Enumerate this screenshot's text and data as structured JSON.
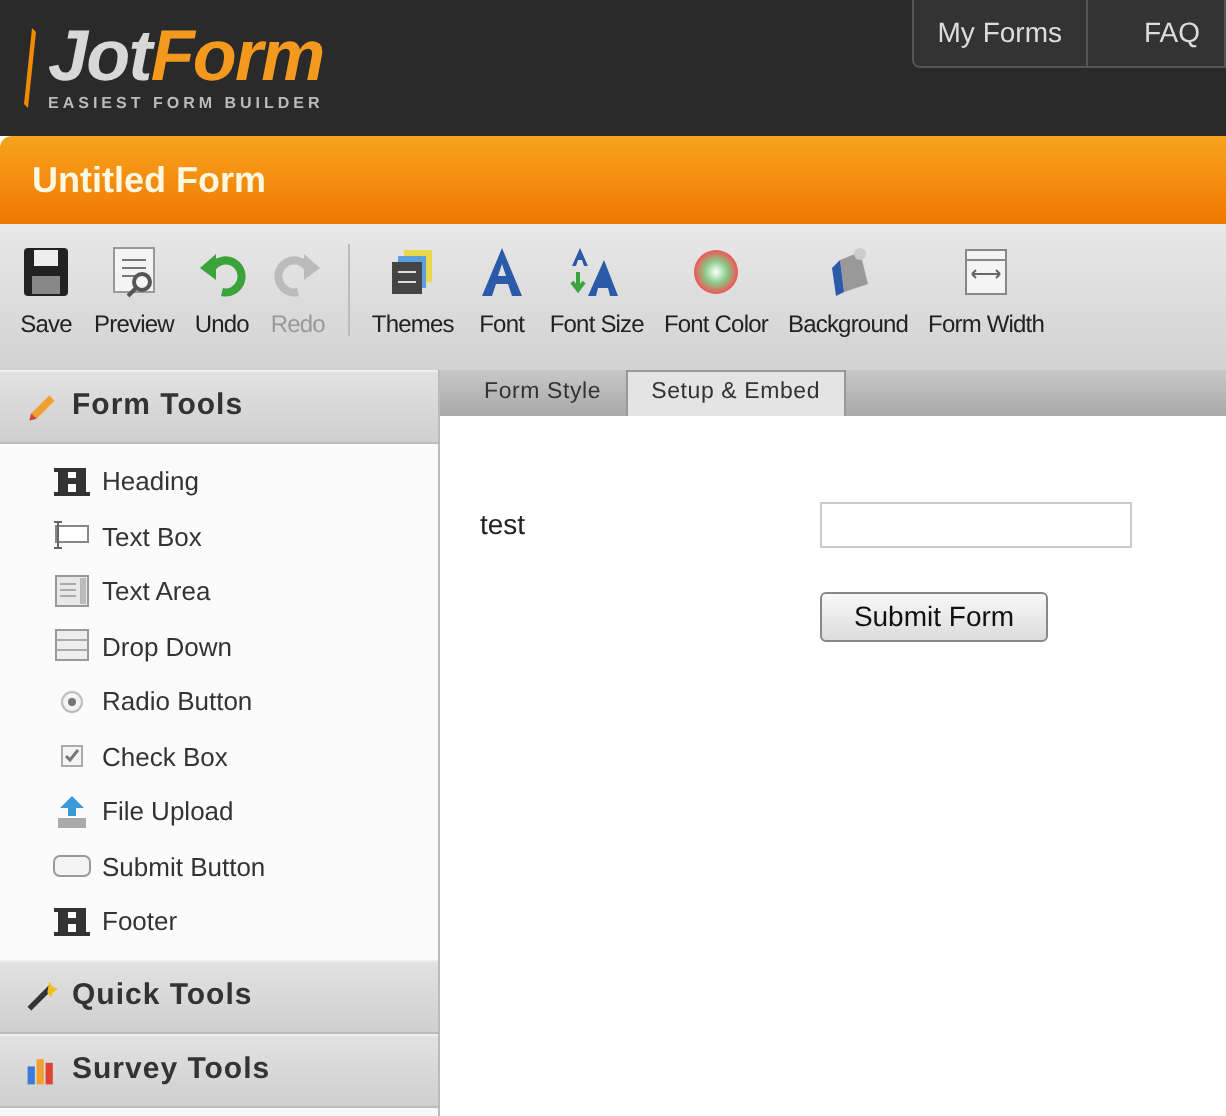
{
  "header": {
    "logo": {
      "brand_a": "Jot",
      "brand_b": "Form",
      "tagline": "EASIEST FORM BUILDER"
    },
    "nav": [
      "My Forms",
      "FAQ"
    ]
  },
  "form_title": "Untitled Form",
  "toolbar": [
    {
      "kind": "save",
      "label": "Save",
      "disabled": false
    },
    {
      "kind": "preview",
      "label": "Preview",
      "disabled": false
    },
    {
      "kind": "undo",
      "label": "Undo",
      "disabled": false
    },
    {
      "kind": "redo",
      "label": "Redo",
      "disabled": true
    },
    {
      "kind": "themes",
      "label": "Themes",
      "disabled": false
    },
    {
      "kind": "font",
      "label": "Font",
      "disabled": false
    },
    {
      "kind": "fontsize",
      "label": "Font Size",
      "disabled": false
    },
    {
      "kind": "fontcolor",
      "label": "Font Color",
      "disabled": false
    },
    {
      "kind": "background",
      "label": "Background",
      "disabled": false
    },
    {
      "kind": "formwidth",
      "label": "Form Width",
      "disabled": false
    }
  ],
  "sidebar": [
    {
      "kind": "form",
      "title": "Form Tools",
      "expanded": true,
      "items": [
        {
          "kind": "heading",
          "label": "Heading"
        },
        {
          "kind": "textbox",
          "label": "Text Box"
        },
        {
          "kind": "textarea",
          "label": "Text Area"
        },
        {
          "kind": "dropdown",
          "label": "Drop Down"
        },
        {
          "kind": "radio",
          "label": "Radio Button"
        },
        {
          "kind": "checkbox",
          "label": "Check Box"
        },
        {
          "kind": "upload",
          "label": "File Upload"
        },
        {
          "kind": "submit",
          "label": "Submit Button"
        },
        {
          "kind": "heading",
          "label": "Footer"
        }
      ]
    },
    {
      "kind": "quick",
      "title": "Quick Tools",
      "expanded": false
    },
    {
      "kind": "survey",
      "title": "Survey Tools",
      "expanded": false
    }
  ],
  "tabs": [
    {
      "label": "Form Style",
      "selected": false
    },
    {
      "label": "Setup & Embed",
      "selected": true
    }
  ],
  "form": {
    "field_label": "test",
    "submit": "Submit Form"
  }
}
